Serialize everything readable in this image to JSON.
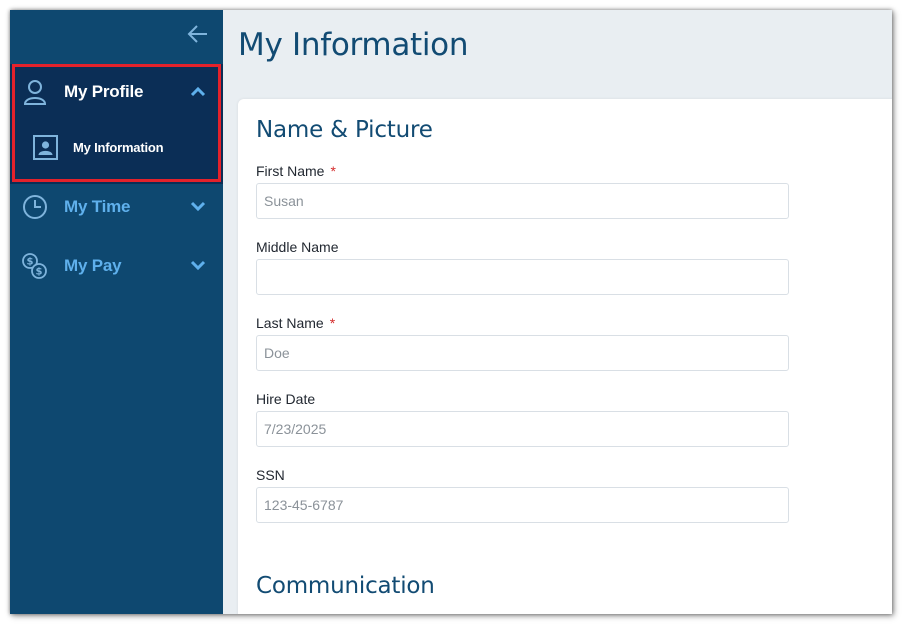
{
  "sidebar": {
    "collapse_icon": "arrow-left-icon",
    "items": [
      {
        "label": "My Profile",
        "icon": "person-icon",
        "expanded": true,
        "sub_items": [
          {
            "label": "My Information",
            "icon": "contact-card-icon"
          }
        ]
      },
      {
        "label": "My Time",
        "icon": "clock-icon",
        "expanded": false
      },
      {
        "label": "My Pay",
        "icon": "coins-icon",
        "expanded": false
      }
    ]
  },
  "page": {
    "title": "My Information"
  },
  "form": {
    "sections": [
      {
        "title": "Name & Picture"
      },
      {
        "title": "Communication"
      }
    ],
    "fields": [
      {
        "label": "First Name",
        "required": "*",
        "value": "Susan"
      },
      {
        "label": "Middle Name",
        "value": ""
      },
      {
        "label": "Last Name",
        "required": "*",
        "value": "Doe"
      },
      {
        "label": "Hire Date",
        "value": "7/23/2025"
      },
      {
        "label": "SSN",
        "value": "123-45-6787"
      }
    ]
  },
  "colors": {
    "sidebar_bg": "#0e4870",
    "active_group_bg": "#0b2e56",
    "highlight": "#e4222b",
    "link_blue": "#5fb0ec",
    "title_blue": "#124b73",
    "required_red": "#d42a2a"
  }
}
